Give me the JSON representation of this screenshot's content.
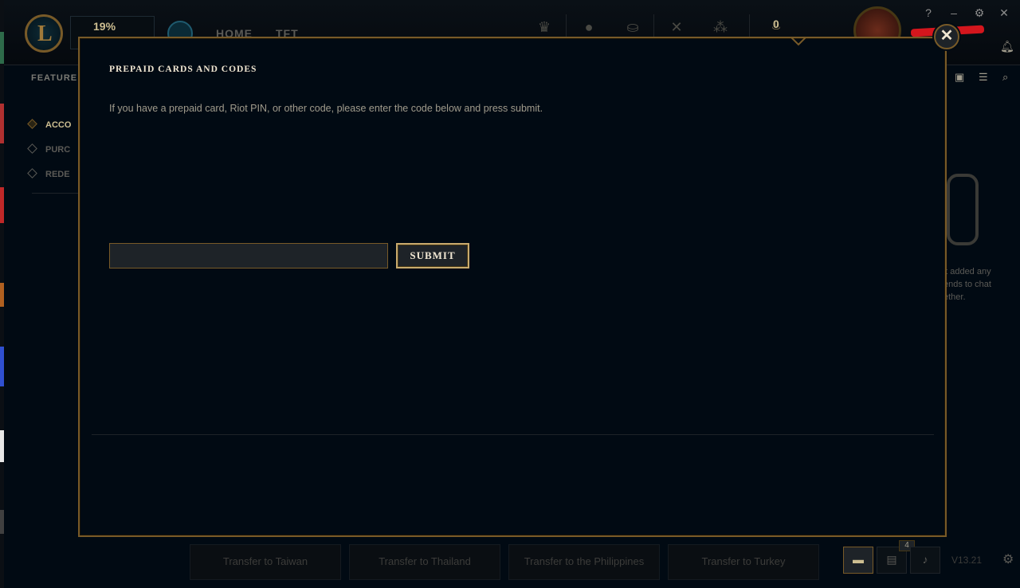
{
  "header": {
    "xp_percent": "19%",
    "nav": [
      "HOME",
      "TFT"
    ],
    "currency_amount": "0",
    "window_controls": [
      "?",
      "–",
      "⚙",
      "✕"
    ]
  },
  "subnav": {
    "featured_label": "FEATURE",
    "side_items": [
      {
        "label": "ACCO",
        "active": true
      },
      {
        "label": "PURC",
        "active": false
      },
      {
        "label": "REDE",
        "active": false
      }
    ]
  },
  "social": {
    "empty_text": [
      "'t added any",
      "ends to chat",
      "ether."
    ]
  },
  "footer": {
    "transfers": [
      "Transfer to Taiwan",
      "Transfer to Thailand",
      "Transfer to the Philippines",
      "Transfer to Turkey"
    ],
    "badge_count": "4",
    "version": "V13.21"
  },
  "modal": {
    "title": "PREPAID CARDS AND CODES",
    "description": "If you have a prepaid card, Riot PIN, or other code, please enter the code below and press submit.",
    "code_input_value": "",
    "code_input_placeholder": "",
    "submit_label": "SUBMIT",
    "close_label": "✕"
  },
  "colors": {
    "gold": "#785a28",
    "gold_light": "#c8aa6e",
    "background": "#010a13",
    "text": "#a09b8c",
    "title_text": "#f0e6d2"
  }
}
